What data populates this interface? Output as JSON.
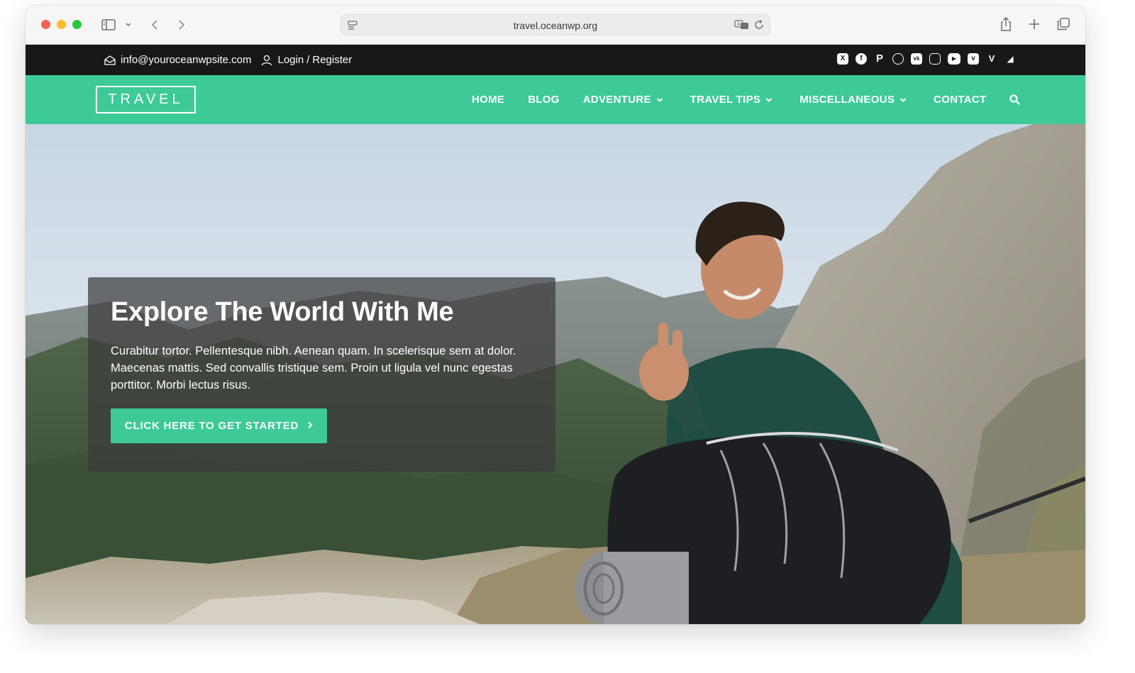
{
  "browser": {
    "url": "travel.oceanwp.org",
    "icons": [
      "sidebar-icon",
      "chevron-down-icon",
      "back-icon",
      "forward-icon",
      "translate-icon",
      "reload-icon",
      "share-icon",
      "new-tab-icon",
      "tabs-icon"
    ]
  },
  "topbar": {
    "email": "info@youroceanwpsite.com",
    "login": "Login",
    "separator": "/",
    "register": "Register",
    "socials": [
      "x",
      "facebook",
      "pinterest",
      "dribbble",
      "vk",
      "instagram",
      "youtube",
      "vimeo",
      "vine",
      "rss"
    ]
  },
  "header": {
    "logo": "TRAVEL",
    "nav": [
      {
        "label": "HOME",
        "dropdown": false
      },
      {
        "label": "BLOG",
        "dropdown": false
      },
      {
        "label": "ADVENTURE",
        "dropdown": true
      },
      {
        "label": "TRAVEL TIPS",
        "dropdown": true
      },
      {
        "label": "MISCELLANEOUS",
        "dropdown": true
      },
      {
        "label": "CONTACT",
        "dropdown": false
      }
    ]
  },
  "hero": {
    "title": "Explore The World With Me",
    "text": "Curabitur tortor. Pellentesque nibh. Aenean quam. In scelerisque sem at dolor. Maecenas mattis. Sed convallis tristique sem. Proin ut ligula vel nunc egestas porttitor. Morbi lectus risus.",
    "cta": "CLICK HERE TO GET STARTED"
  },
  "colors": {
    "accent": "#3dca96",
    "topbar": "#17181a"
  }
}
